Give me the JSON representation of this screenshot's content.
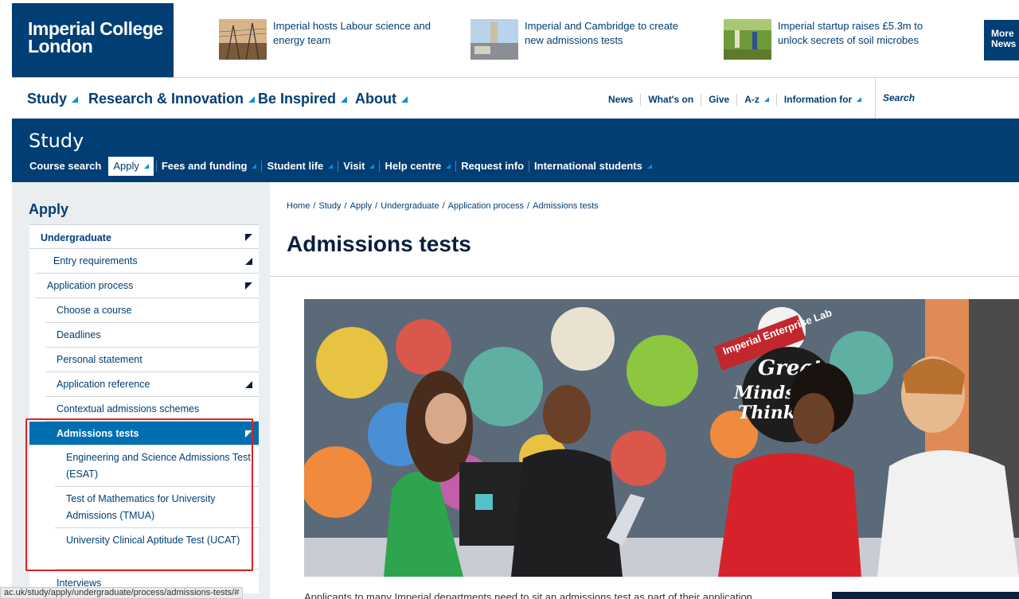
{
  "header": {
    "logo_text": "Imperial College London",
    "news": [
      {
        "title": "Imperial hosts Labour science and energy team"
      },
      {
        "title": "Imperial and Cambridge to create new admissions tests"
      },
      {
        "title": "Imperial startup raises £5.3m to unlock secrets of soil microbes"
      }
    ],
    "more_news_label": "More News"
  },
  "main_nav": {
    "items": [
      "Study",
      "Research & Innovation",
      "Be Inspired",
      "About"
    ],
    "utility": [
      "News",
      "What's on",
      "Give",
      "A-z",
      "Information for"
    ],
    "search_label": "Search"
  },
  "study_bar": {
    "title": "Study",
    "subnav": [
      "Course search",
      "Apply",
      "Fees and funding",
      "Student life",
      "Visit",
      "Help centre",
      "Request info",
      "International students"
    ],
    "active": "Apply"
  },
  "sidebar": {
    "heading": "Apply",
    "items": [
      {
        "label": "Undergraduate"
      },
      {
        "label": "Entry requirements"
      },
      {
        "label": "Application process"
      },
      {
        "label": "Choose a course"
      },
      {
        "label": "Deadlines"
      },
      {
        "label": "Personal statement"
      },
      {
        "label": "Application reference"
      },
      {
        "label": "Contextual admissions schemes"
      },
      {
        "label": "Admissions tests"
      },
      {
        "label": "Engineering and Science Admissions Test (ESAT)"
      },
      {
        "label": "Test of Mathematics for University Admissions (TMUA)"
      },
      {
        "label": "University Clinical Aptitude Test (UCAT)"
      },
      {
        "label": "Interviews"
      }
    ]
  },
  "status_url": "ac.uk/study/apply/undergraduate/process/admissions-tests/#",
  "content": {
    "breadcrumb": [
      "Home",
      "Study",
      "Apply",
      "Undergraduate",
      "Application process",
      "Admissions tests"
    ],
    "title": "Admissions tests",
    "hero_texts": {
      "lab_sign": "Imperial Enterprise Lab",
      "slogan_1": "Great",
      "slogan_2": "Minds D",
      "slogan_3": "Think A"
    },
    "intro": "Applicants to many Imperial departments need to sit an admissions test as part of their application."
  },
  "colors": {
    "navy": "#003e74",
    "active_blue": "#006eaf",
    "accent": "#0092d2",
    "highlight_border": "#dd2222"
  }
}
